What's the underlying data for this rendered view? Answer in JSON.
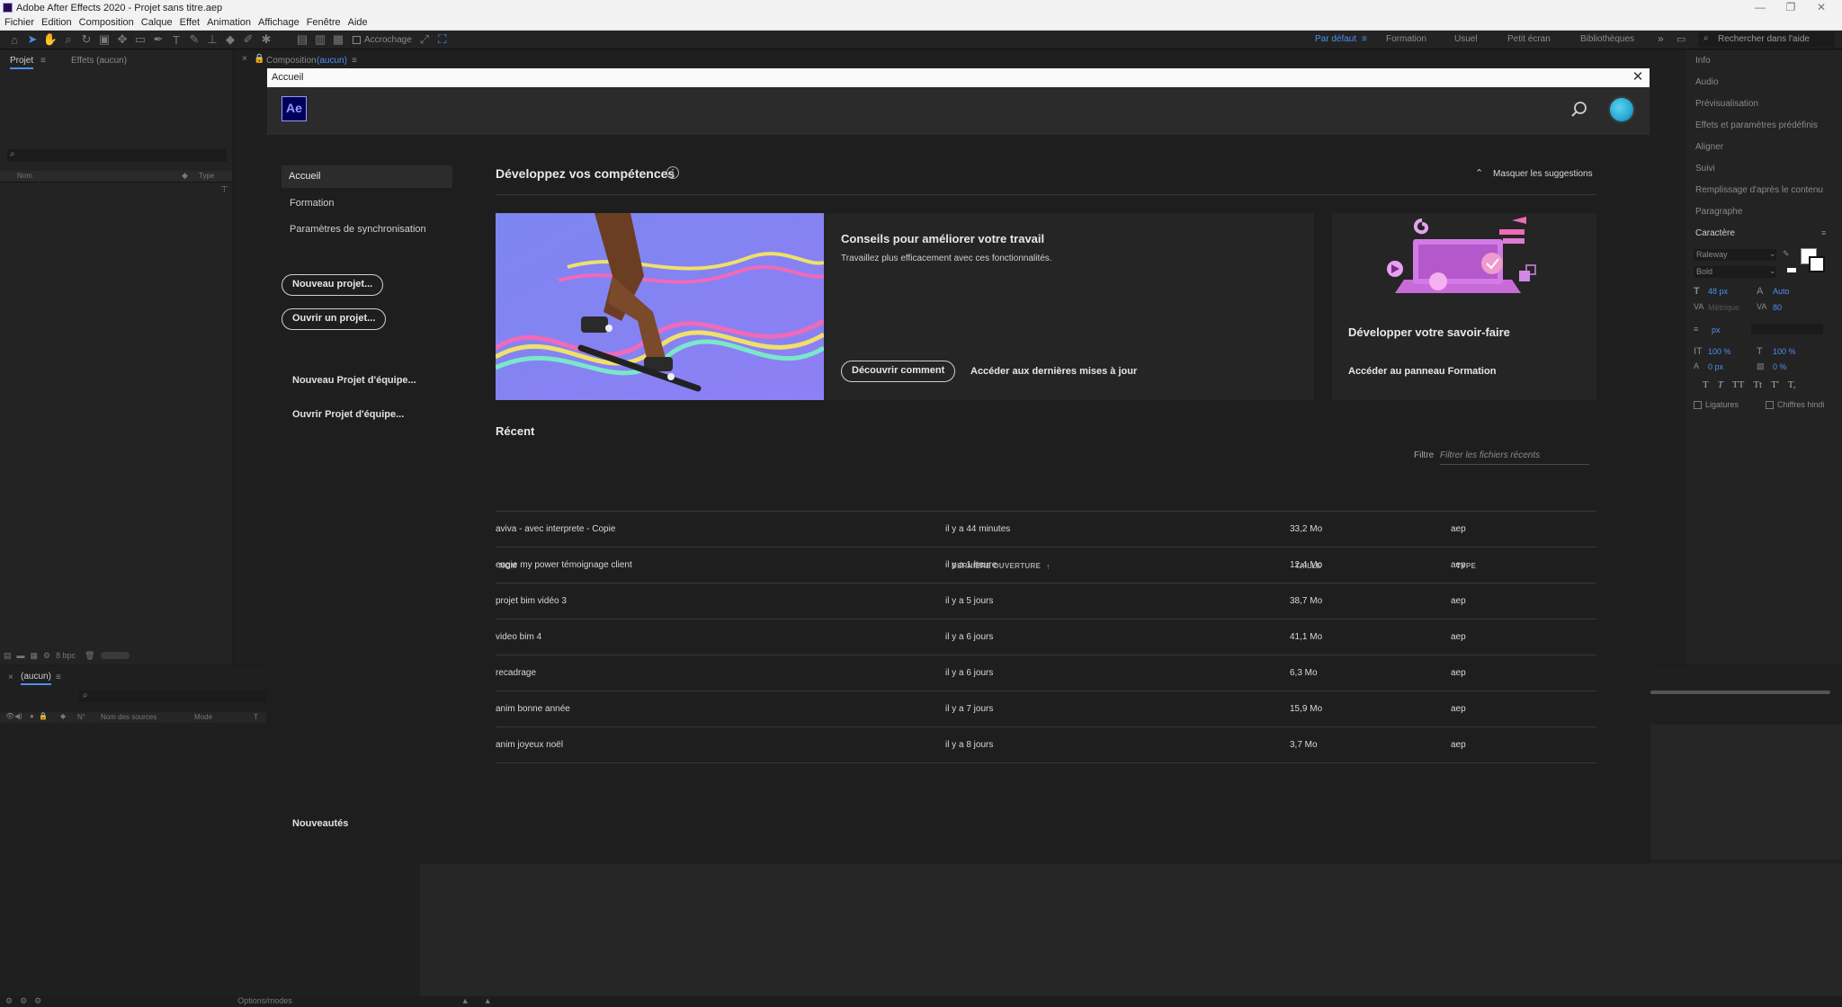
{
  "app": {
    "window_title": "Adobe After Effects 2020 - Projet sans titre.aep"
  },
  "menu": [
    "Fichier",
    "Edition",
    "Composition",
    "Calque",
    "Effet",
    "Animation",
    "Affichage",
    "Fenêtre",
    "Aide"
  ],
  "toolbar": {
    "snapping_label": "Accrochage",
    "workspaces": [
      {
        "label": "Par défaut",
        "active": true
      },
      {
        "label": "Formation",
        "active": false
      },
      {
        "label": "Usuel",
        "active": false
      },
      {
        "label": "Petit écran",
        "active": false
      },
      {
        "label": "Bibliothèques",
        "active": false
      }
    ],
    "search_help": "Rechercher dans l'aide"
  },
  "project_panel": {
    "tab_project": "Projet",
    "tab_effects": "Effets (aucun)",
    "col_name": "Nom",
    "col_type": "Type",
    "bpc": "8 bpc"
  },
  "composition_panel": {
    "tab_label": "Composition",
    "tab_value": "(aucun)"
  },
  "timeline_panel": {
    "tab_label": "(aucun)",
    "col_num": "N°",
    "col_source": "Nom des sources",
    "col_mode": "Mode",
    "col_t": "T",
    "options_modes": "Options/modes"
  },
  "right_panel": {
    "items": [
      "Info",
      "Audio",
      "Prévisualisation",
      "Effets et paramètres prédéfinis",
      "Aligner",
      "Suivi",
      "Remplissage d'après le contenu",
      "Paragraphe"
    ],
    "character": {
      "title": "Caractère",
      "font": "Raleway",
      "style": "Bold",
      "size": "48 px",
      "leading": "Auto",
      "kerning": "Métrique",
      "tracking": "80",
      "stroke": "px",
      "vscale": "100 %",
      "hscale": "100 %",
      "baseline": "0 px",
      "tsume": "0 %",
      "ligatures": "Ligatures",
      "hindi": "Chiffres hindi"
    }
  },
  "modal": {
    "title": "Accueil",
    "close": "✕",
    "logo": "Ae",
    "sidebar": {
      "items": [
        "Accueil",
        "Formation",
        "Paramètres de synchronisation"
      ],
      "new_project": "Nouveau projet...",
      "open_project": "Ouvrir un projet...",
      "new_team_project": "Nouveau Projet d'équipe...",
      "open_team_project": "Ouvrir Projet d'équipe...",
      "news": "Nouveautés"
    },
    "skills": {
      "title": "Développez vos compétences",
      "hide": "Masquer les suggestions",
      "card1": {
        "title": "Conseils pour améliorer votre travail",
        "subtitle": "Travaillez plus efficacement avec ces fonctionnalités.",
        "button": "Découvrir comment",
        "link": "Accéder aux dernières mises à jour"
      },
      "card2": {
        "title": "Développer votre savoir-faire",
        "link": "Accéder au panneau Formation"
      }
    },
    "recent": {
      "title": "Récent",
      "filter_label": "Filtre",
      "filter_placeholder": "Filtrer les fichiers récents",
      "columns": [
        "NOM",
        "DERNIÈRE OUVERTURE",
        "TAILLE",
        "TYPE"
      ],
      "rows": [
        {
          "name": "aviva - avec interprete - Copie",
          "opened": "il y a 44 minutes",
          "size": "33,2 Mo",
          "type": "aep"
        },
        {
          "name": "engie my power témoignage client",
          "opened": "il y a 1 heure",
          "size": "12,4 Mo",
          "type": "aep"
        },
        {
          "name": "projet bim vidéo 3",
          "opened": "il y a 5 jours",
          "size": "38,7 Mo",
          "type": "aep"
        },
        {
          "name": "video bim 4",
          "opened": "il y a 6 jours",
          "size": "41,1 Mo",
          "type": "aep"
        },
        {
          "name": "recadrage",
          "opened": "il y a 6 jours",
          "size": "6,3 Mo",
          "type": "aep"
        },
        {
          "name": "anim bonne année",
          "opened": "il y a 7 jours",
          "size": "15,9 Mo",
          "type": "aep"
        },
        {
          "name": "anim joyeux noël",
          "opened": "il y a 8 jours",
          "size": "3,7 Mo",
          "type": "aep"
        }
      ]
    }
  },
  "colors": {
    "accent": "#4d8ef0",
    "ae_purple": "#9999ff",
    "ae_bg": "#00005b"
  }
}
